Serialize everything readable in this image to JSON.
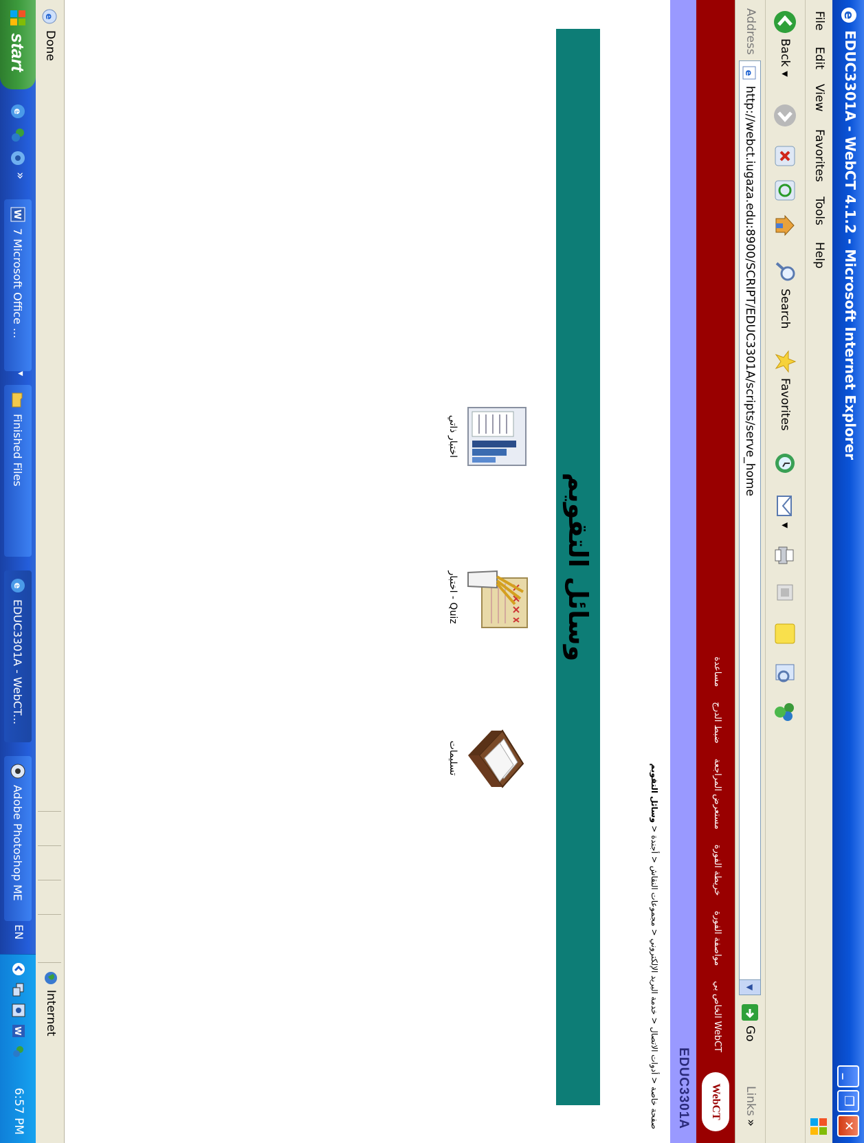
{
  "window": {
    "title": "EDUC3301A - WebCT 4.1.2 - Microsoft Internet Explorer"
  },
  "menu": [
    "File",
    "Edit",
    "View",
    "Favorites",
    "Tools",
    "Help"
  ],
  "toolbar": {
    "back": "Back",
    "search": "Search",
    "favorites": "Favorites"
  },
  "address": {
    "label": "Address",
    "url": "http://webct.iugaza.edu:8900/SCRIPT/EDUC3301A/scripts/serve_home",
    "go": "Go",
    "links": "Links"
  },
  "webct": {
    "logo": "WebCT",
    "nav": [
      "WebCT الخاص بي",
      "مواصفة الفورة",
      "خريطة الفورة",
      "مستعرض المراجعة",
      "ضبط الدرج",
      "مساعدة"
    ],
    "course_id": "EDUC3301A",
    "breadcrumb": [
      "صفحة خاصة",
      "أدوات الاتصال",
      "خدمة البريد الإلكتروني",
      "مجموعات النقاش",
      "أجندة"
    ],
    "breadcrumb_sep": " < ",
    "breadcrumb_current": "وسائل التقويم"
  },
  "page": {
    "title": "وسائل التقويم",
    "tools": [
      {
        "label": "اختبار ذاتي",
        "icon": "self-test-icon"
      },
      {
        "label": "Quiz - اختبار",
        "icon": "quiz-icon"
      },
      {
        "label": "تسليمات",
        "icon": "assignments-icon"
      }
    ]
  },
  "status": {
    "text": "Done",
    "zone": "Internet"
  },
  "taskbar": {
    "start": "start",
    "items": [
      "7 Microsoft Office ...",
      "Finished Files",
      "EDUC3301A - WebCT...",
      "Adobe Photoshop ME"
    ],
    "lang": "EN",
    "clock": "6:57 PM"
  },
  "colors": {
    "webct_red": "#990000",
    "course_bar": "#9999ff",
    "banner_teal": "#0d7d76"
  }
}
